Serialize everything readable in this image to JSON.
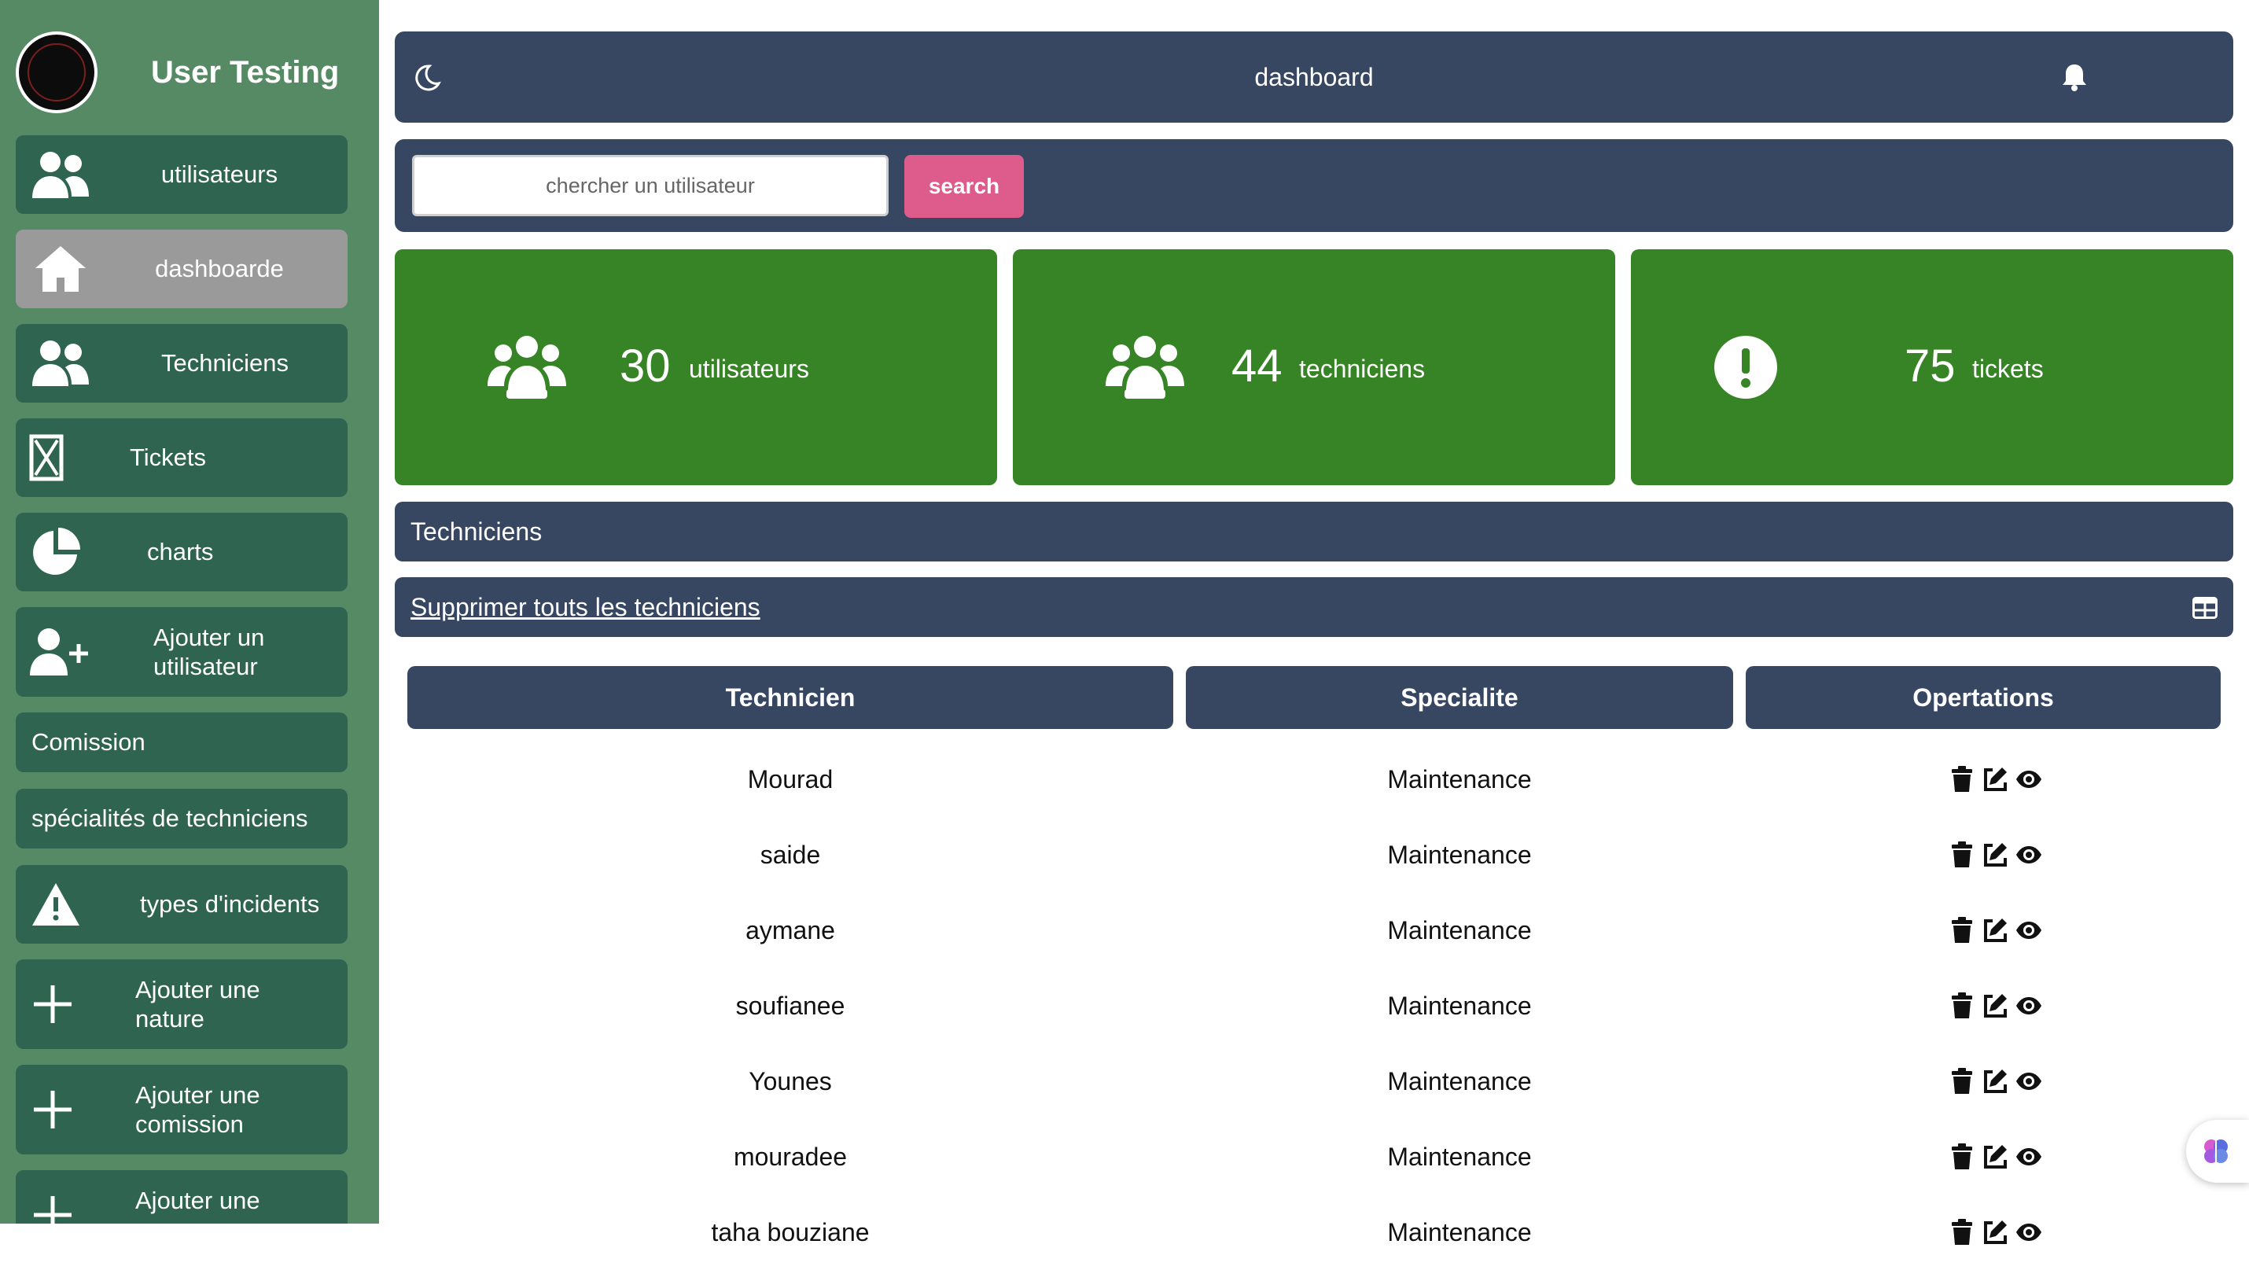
{
  "app": {
    "title": "User Testing"
  },
  "sidebar": {
    "items": [
      {
        "label": "utilisateurs",
        "icon": "users-icon"
      },
      {
        "label": "dashboarde",
        "icon": "home-icon",
        "active": true
      },
      {
        "label": "Techniciens",
        "icon": "users-icon"
      },
      {
        "label": "Tickets",
        "icon": "ticket-icon"
      },
      {
        "label": "charts",
        "icon": "pie-chart-icon"
      },
      {
        "label": "Ajouter un utilisateur",
        "icon": "user-plus-icon"
      },
      {
        "label": "Comission"
      },
      {
        "label": "spécialités de techniciens"
      },
      {
        "label": "types d'incidents",
        "icon": "warning-icon"
      },
      {
        "label": "Ajouter une nature",
        "icon": "plus-icon"
      },
      {
        "label": "Ajouter une comission",
        "icon": "plus-icon"
      },
      {
        "label": "Ajouter une",
        "icon": "plus-icon"
      }
    ]
  },
  "header": {
    "title": "dashboard",
    "left_icon": "moon-icon",
    "right_icon": "bell-icon"
  },
  "search": {
    "placeholder": "chercher un utilisateur",
    "value": "",
    "button_label": "search"
  },
  "stats": [
    {
      "value": "30",
      "label": "utilisateurs",
      "icon": "users-icon"
    },
    {
      "value": "44",
      "label": "techniciens",
      "icon": "users-icon"
    },
    {
      "value": "75",
      "label": "tickets",
      "icon": "exclamation-circle-icon"
    }
  ],
  "colors": {
    "sidebar": "#558a64",
    "nav_item": "#2f6451",
    "nav_active": "#9a9a9a",
    "panel": "#374762",
    "card": "#368425",
    "search_button": "#dd5c8c"
  },
  "section": {
    "title": "Techniciens",
    "delete_all_label": "Supprimer touts les techniciens",
    "table_icon": "table-icon"
  },
  "table": {
    "headers": [
      "Technicien",
      "Specialite",
      "Opertations"
    ],
    "rows": [
      {
        "technicien": "Mourad",
        "specialite": "Maintenance"
      },
      {
        "technicien": "saide",
        "specialite": "Maintenance"
      },
      {
        "technicien": "aymane",
        "specialite": "Maintenance"
      },
      {
        "technicien": "soufianee",
        "specialite": "Maintenance"
      },
      {
        "technicien": "Younes",
        "specialite": "Maintenance"
      },
      {
        "technicien": "mouradee",
        "specialite": "Maintenance"
      },
      {
        "technicien": "taha bouziane",
        "specialite": "Maintenance"
      }
    ],
    "operation_icons": [
      "trash-icon",
      "edit-icon",
      "eye-icon"
    ]
  }
}
